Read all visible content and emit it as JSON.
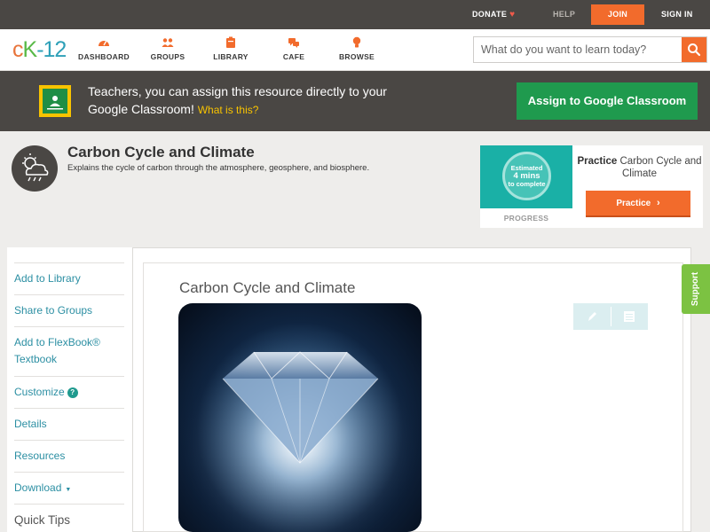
{
  "topbar": {
    "donate": "DONATE",
    "help": "HELP",
    "join": "JOIN",
    "signin": "SIGN IN"
  },
  "header": {
    "logo_c": "c",
    "logo_k": "K",
    "logo_n": "-12",
    "nav": [
      {
        "label": "DASHBOARD",
        "icon": "dashboard-icon"
      },
      {
        "label": "GROUPS",
        "icon": "groups-icon"
      },
      {
        "label": "LIBRARY",
        "icon": "library-icon"
      },
      {
        "label": "CAFE",
        "icon": "cafe-icon"
      },
      {
        "label": "BROWSE",
        "icon": "browse-icon"
      }
    ],
    "search_placeholder": "What do you want to learn today?"
  },
  "banner": {
    "text": "Teachers, you can assign this resource directly to your Google Classroom!",
    "link": "What is this?",
    "button": "Assign to Google Classroom"
  },
  "concept": {
    "title": "Carbon Cycle and Climate",
    "description": "Explains the cycle of carbon through the atmosphere, geosphere, and biosphere."
  },
  "practice": {
    "estimated_line1": "Estimated",
    "estimated_mins": "4 mins",
    "estimated_line3": "to complete",
    "progress_label": "PROGRESS",
    "title_bold": "Practice",
    "title_rest": "Carbon Cycle and Climate",
    "button": "Practice"
  },
  "sidebar": {
    "items": [
      "Add to Library",
      "Share to Groups",
      "Add to FlexBook® Textbook",
      "Customize",
      "Details",
      "Resources",
      "Download",
      "Quick Tips"
    ]
  },
  "content": {
    "title": "Carbon Cycle and Climate"
  },
  "support": "Support",
  "colors": {
    "accent_orange": "#f26b2c",
    "classroom_green": "#1f9a4e",
    "dark_bar": "#4a4744",
    "link_teal": "#2c8fa3",
    "support_green": "#7cc242"
  }
}
